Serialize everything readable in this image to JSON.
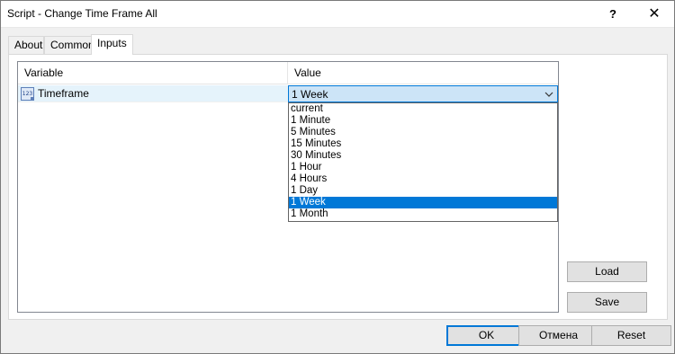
{
  "window": {
    "title": "Script - Change Time Frame All",
    "help_label": "?",
    "close_label": "✕"
  },
  "tabs": [
    {
      "label": "About"
    },
    {
      "label": "Common"
    },
    {
      "label": "Inputs",
      "active": true
    }
  ],
  "grid": {
    "columns": [
      "Variable",
      "Value"
    ],
    "rows": [
      {
        "icon": "123",
        "variable": "Timeframe",
        "value": "1 Week"
      }
    ]
  },
  "dropdown": {
    "options": [
      "current",
      "1 Minute",
      "5 Minutes",
      "15 Minutes",
      "30 Minutes",
      "1 Hour",
      "4 Hours",
      "1 Day",
      "1 Week",
      "1 Month"
    ],
    "selected": "1 Week"
  },
  "buttons": {
    "load": "Load",
    "save": "Save",
    "ok": "OK",
    "cancel": "Отмена",
    "reset": "Reset"
  },
  "colors": {
    "accent": "#0078d7",
    "row_highlight": "#e5f3fb",
    "combo_bg": "#cce4f7"
  }
}
